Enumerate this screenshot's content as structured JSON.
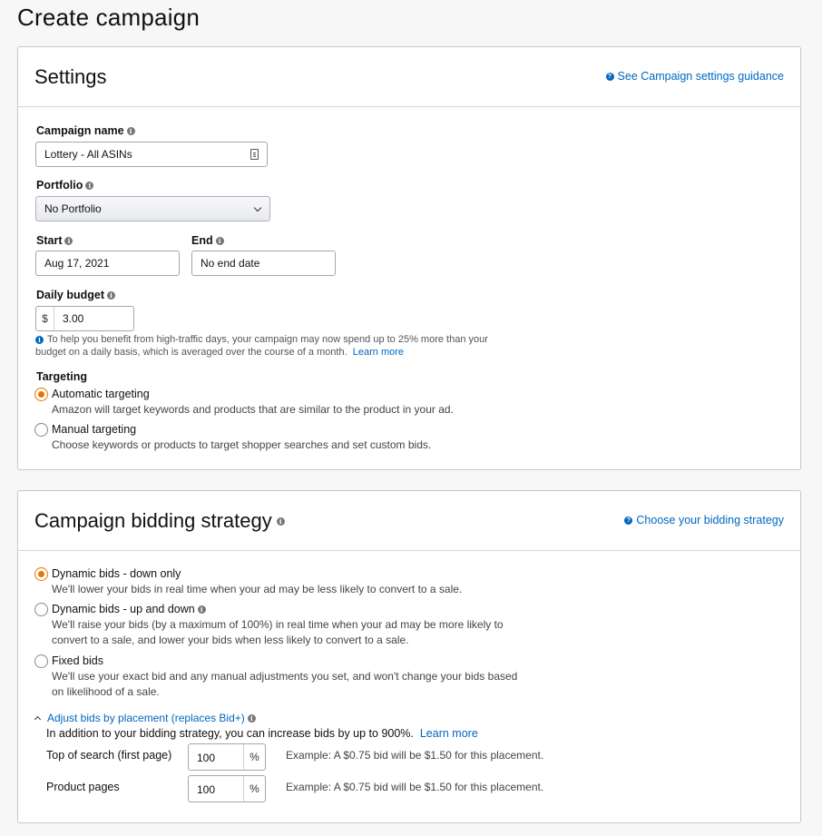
{
  "page": {
    "title": "Create campaign"
  },
  "settings": {
    "title": "Settings",
    "guidance_link": "See Campaign settings guidance",
    "campaign_name": {
      "label": "Campaign name",
      "value": "Lottery - All ASINs"
    },
    "portfolio": {
      "label": "Portfolio",
      "value": "No Portfolio"
    },
    "start": {
      "label": "Start",
      "value": "Aug 17, 2021"
    },
    "end": {
      "label": "End",
      "value": "No end date"
    },
    "daily_budget": {
      "label": "Daily budget",
      "currency": "$",
      "value": "3.00",
      "note": "To help you benefit from high-traffic days, your campaign may now spend up to 25% more than your budget on a daily basis, which is averaged over the course of a month.",
      "learn_more": "Learn more"
    },
    "targeting": {
      "label": "Targeting",
      "options": [
        {
          "title": "Automatic targeting",
          "desc": "Amazon will target keywords and products that are similar to the product in your ad.",
          "selected": true
        },
        {
          "title": "Manual targeting",
          "desc": "Choose keywords or products to target shopper searches and set custom bids.",
          "selected": false
        }
      ]
    }
  },
  "bidding": {
    "title": "Campaign bidding strategy",
    "guidance_link": "Choose your bidding strategy",
    "options": [
      {
        "title": "Dynamic bids - down only",
        "desc": "We'll lower your bids in real time when your ad may be less likely to convert to a sale.",
        "selected": true
      },
      {
        "title": "Dynamic bids - up and down",
        "desc1": "We'll raise your bids (by a maximum of 100%) in real time when your ad may be more likely to",
        "desc2": "convert to a sale, and lower your bids when less likely to convert to a sale.",
        "selected": false
      },
      {
        "title": "Fixed bids",
        "desc1": "We'll use your exact bid and any manual adjustments you set, and won't change your bids based",
        "desc2": "on likelihood of a sale.",
        "selected": false
      }
    ],
    "placement": {
      "toggle": "Adjust bids by placement (replaces Bid+)",
      "intro": "In addition to your bidding strategy, you can increase bids by up to 900%.",
      "learn_more": "Learn more",
      "rows": [
        {
          "label": "Top of search (first page)",
          "value": "100",
          "unit": "%",
          "example": "Example: A $0.75 bid will be $1.50 for this placement."
        },
        {
          "label": "Product pages",
          "value": "100",
          "unit": "%",
          "example": "Example: A $0.75 bid will be $1.50 for this placement."
        }
      ]
    }
  }
}
